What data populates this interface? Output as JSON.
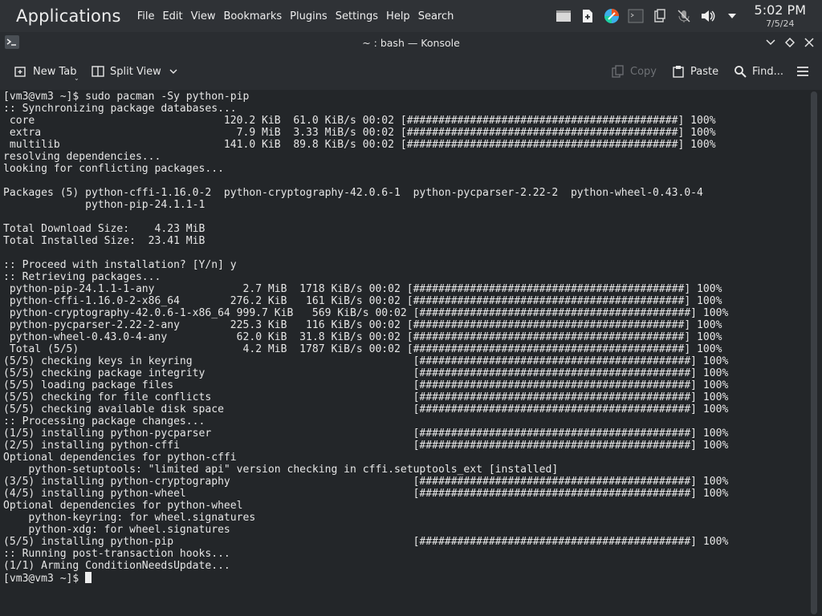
{
  "panel": {
    "app_title": "Applications",
    "menu": [
      "File",
      "Edit",
      "View",
      "Bookmarks",
      "Plugins",
      "Settings",
      "Help",
      "Search"
    ],
    "clock": {
      "time": "5:02 PM",
      "date": "7/5/24"
    }
  },
  "window": {
    "title": "~ : bash — Konsole"
  },
  "toolbar": {
    "new_tab": "New Tab",
    "split_view": "Split View",
    "copy": "Copy",
    "paste": "Paste",
    "find": "Find..."
  },
  "terminal": {
    "lines": [
      "[vm3@vm3 ~]$ sudo pacman -Sy python-pip",
      ":: Synchronizing package databases...",
      " core                              120.2 KiB  61.0 KiB/s 00:02 [###########################################] 100%",
      " extra                               7.9 MiB  3.33 MiB/s 00:02 [###########################################] 100%",
      " multilib                          141.0 KiB  89.8 KiB/s 00:02 [###########################################] 100%",
      "resolving dependencies...",
      "looking for conflicting packages...",
      "",
      "Packages (5) python-cffi-1.16.0-2  python-cryptography-42.0.6-1  python-pycparser-2.22-2  python-wheel-0.43.0-4",
      "             python-pip-24.1.1-1",
      "",
      "Total Download Size:    4.23 MiB",
      "Total Installed Size:  23.41 MiB",
      "",
      ":: Proceed with installation? [Y/n] y",
      ":: Retrieving packages...",
      " python-pip-24.1.1-1-any              2.7 MiB  1718 KiB/s 00:02 [###########################################] 100%",
      " python-cffi-1.16.0-2-x86_64        276.2 KiB   161 KiB/s 00:02 [###########################################] 100%",
      " python-cryptography-42.0.6-1-x86_64 999.7 KiB   569 KiB/s 00:02 [###########################################] 100%",
      " python-pycparser-2.22-2-any        225.3 KiB   116 KiB/s 00:02 [###########################################] 100%",
      " python-wheel-0.43.0-4-any           62.0 KiB  31.8 KiB/s 00:02 [###########################################] 100%",
      " Total (5/5)                          4.2 MiB  1787 KiB/s 00:02 [###########################################] 100%",
      "(5/5) checking keys in keyring                                   [###########################################] 100%",
      "(5/5) checking package integrity                                 [###########################################] 100%",
      "(5/5) loading package files                                      [###########################################] 100%",
      "(5/5) checking for file conflicts                                [###########################################] 100%",
      "(5/5) checking available disk space                              [###########################################] 100%",
      ":: Processing package changes...",
      "(1/5) installing python-pycparser                                [###########################################] 100%",
      "(2/5) installing python-cffi                                     [###########################################] 100%",
      "Optional dependencies for python-cffi",
      "    python-setuptools: \"limited api\" version checking in cffi.setuptools_ext [installed]",
      "(3/5) installing python-cryptography                             [###########################################] 100%",
      "(4/5) installing python-wheel                                    [###########################################] 100%",
      "Optional dependencies for python-wheel",
      "    python-keyring: for wheel.signatures",
      "    python-xdg: for wheel.signatures",
      "(5/5) installing python-pip                                      [###########################################] 100%",
      ":: Running post-transaction hooks...",
      "(1/1) Arming ConditionNeedsUpdate..."
    ],
    "prompt": "[vm3@vm3 ~]$ "
  }
}
